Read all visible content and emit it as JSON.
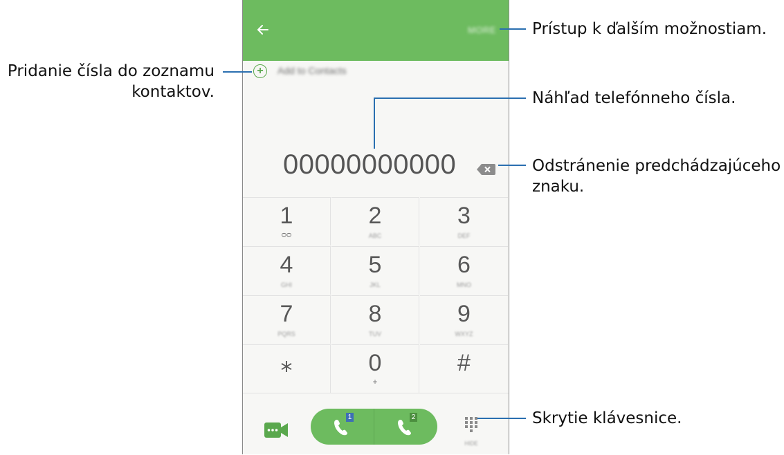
{
  "app_bar": {
    "more_label": "MORE"
  },
  "add_to_contacts": {
    "label": "Add to Contacts"
  },
  "dial_input": {
    "value": "00000000000"
  },
  "keypad": [
    {
      "digit": "1",
      "sub": "ᴑᴑ",
      "sub_name": "voicemail-icon"
    },
    {
      "digit": "2",
      "sub": "ABC"
    },
    {
      "digit": "3",
      "sub": "DEF"
    },
    {
      "digit": "4",
      "sub": "GHI"
    },
    {
      "digit": "5",
      "sub": "JKL"
    },
    {
      "digit": "6",
      "sub": "MNO"
    },
    {
      "digit": "7",
      "sub": "PQRS"
    },
    {
      "digit": "8",
      "sub": "TUV"
    },
    {
      "digit": "9",
      "sub": "WXYZ"
    },
    {
      "digit": "⁎",
      "sub": ""
    },
    {
      "digit": "0",
      "sub": "+"
    },
    {
      "digit": "#",
      "sub": ""
    }
  ],
  "bottom_bar": {
    "call_sim1_badge": "1",
    "call_sim2_badge": "2",
    "hide_label": "HIDE"
  },
  "annotations": {
    "more_options": "Prístup k ďalším možnostiam.",
    "add_contact_line1": "Pridanie čísla do zoznamu",
    "add_contact_line2": "kontaktov.",
    "preview": "Náhľad telefónneho čísla.",
    "delete_line1": "Odstránenie predchádzajúceho",
    "delete_line2": "znaku.",
    "hide_keypad": "Skrytie klávesnice."
  },
  "colors": {
    "accent": "#6dbb5f",
    "callout_line": "#2a6fb0"
  }
}
